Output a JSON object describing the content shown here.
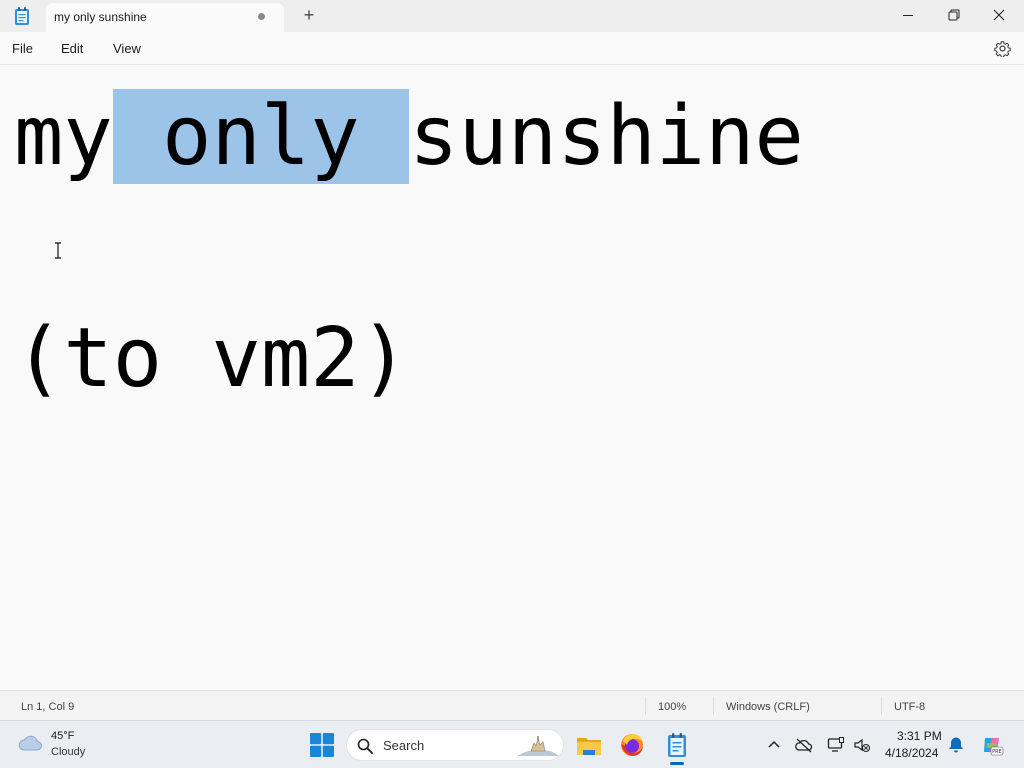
{
  "window": {
    "tab_title": "my only sunshine",
    "new_tab_symbol": "+",
    "unsaved_indicator": "dot",
    "controls": [
      "minimize",
      "restore",
      "close"
    ]
  },
  "menu": {
    "file": "File",
    "edit": "Edit",
    "view": "View",
    "settings_icon": "gear-icon"
  },
  "editor": {
    "line1_before": "my",
    "line1_selected": " only ",
    "line1_after": "sunshine",
    "line2": "(to vm2)",
    "selection_color": "#9bc4e8"
  },
  "status": {
    "position": "Ln 1, Col 9",
    "zoom": "100%",
    "line_ending": "Windows (CRLF)",
    "encoding": "UTF-8"
  },
  "taskbar": {
    "weather_temp": "45°F",
    "weather_desc": "Cloudy",
    "search_placeholder": "Search",
    "pinned": [
      "start-icon",
      "file-explorer-icon",
      "firefox-icon",
      "notepad-icon"
    ],
    "clock_time": "3:31 PM",
    "clock_date": "4/18/2024",
    "accent_color": "#0067c0"
  }
}
